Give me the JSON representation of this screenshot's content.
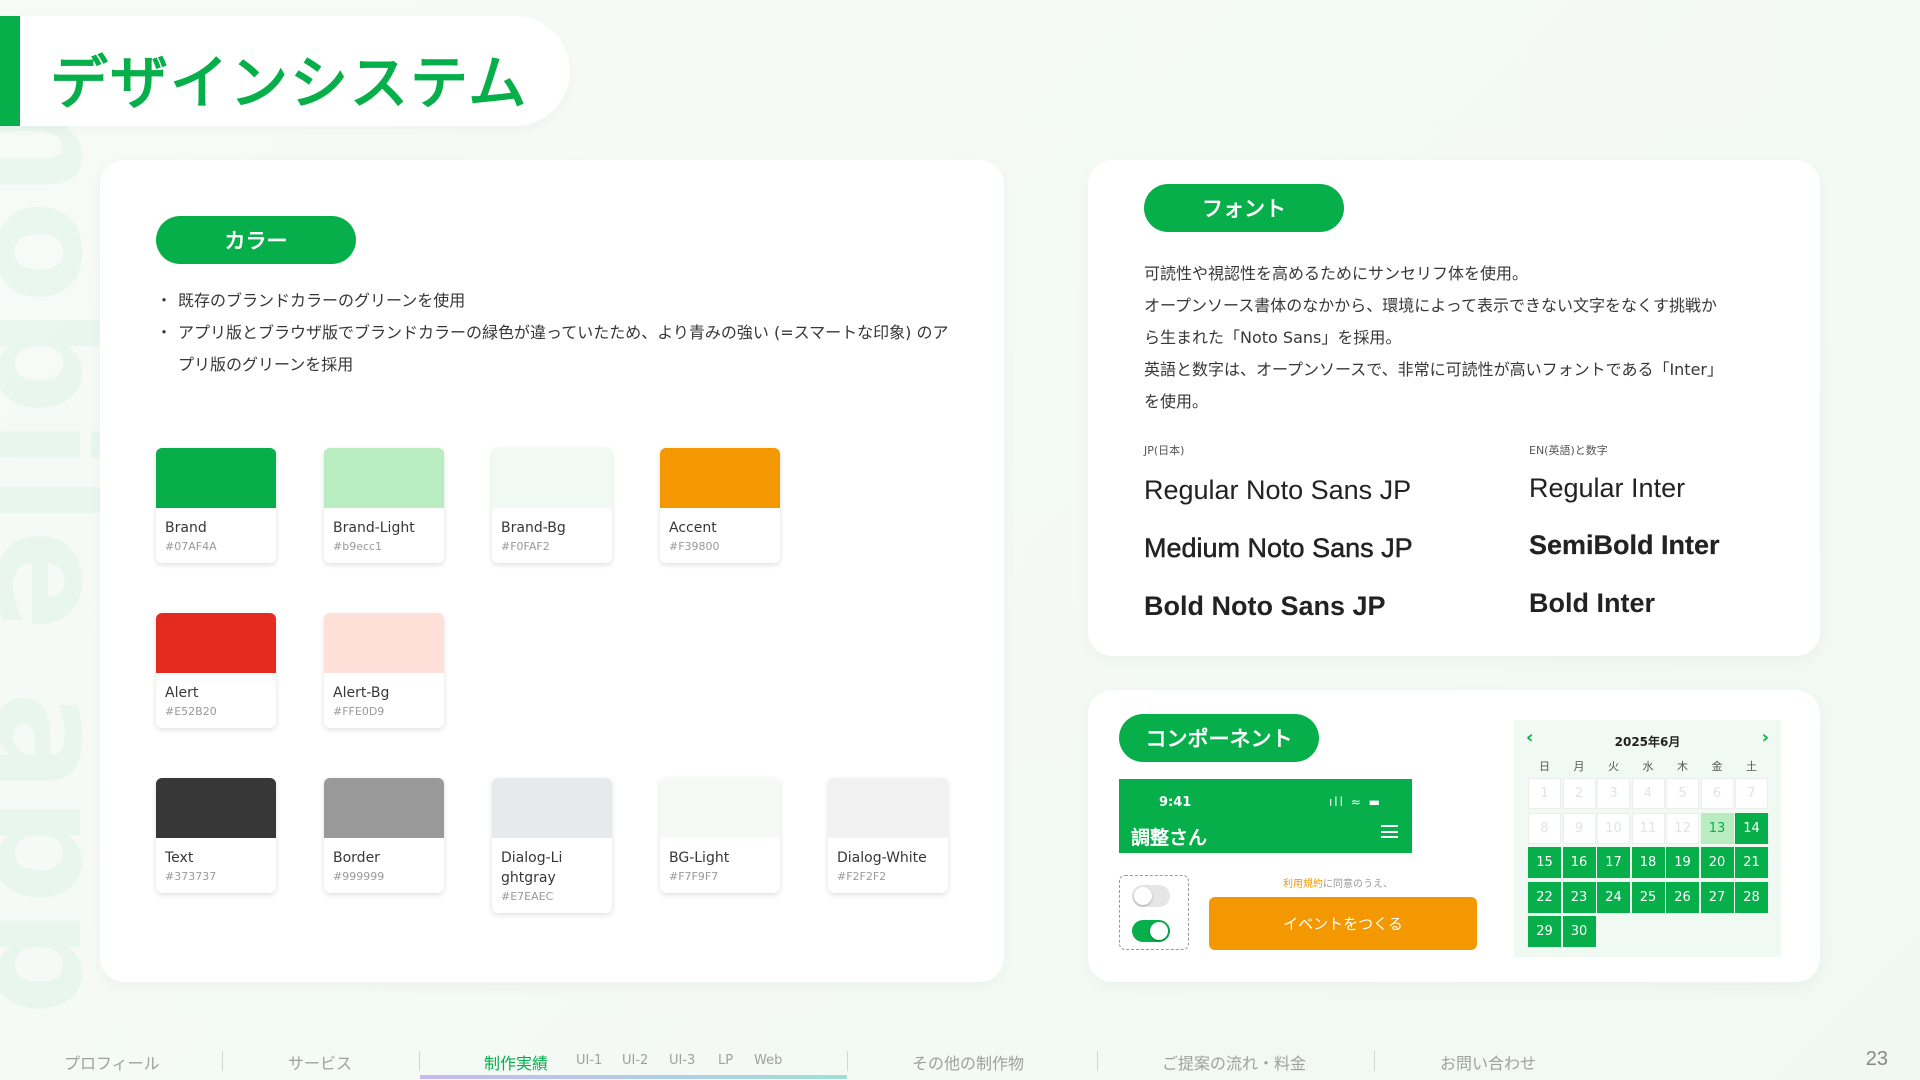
{
  "background_word": "mobile app",
  "page": {
    "title": "デザインシステム",
    "number": "23"
  },
  "colors_card": {
    "pill": "カラー",
    "bullets": [
      "既存のブランドカラーのグリーンを使用",
      "アプリ版とブラウザ版でブランドカラーの緑色が違っていたため、より青みの強い (=スマートな印象) のアプリ版のグリーンを採用"
    ],
    "swatches": [
      {
        "name": "Brand",
        "hex": "#07AF4A",
        "color": "#07AF4A"
      },
      {
        "name": "Brand-Light",
        "hex": "#b9ecc1",
        "color": "#b9ecc1"
      },
      {
        "name": "Brand-Bg",
        "hex": "#F0FAF2",
        "color": "#F0FAF2"
      },
      {
        "name": "Accent",
        "hex": "#F39800",
        "color": "#F39800"
      },
      {
        "name": "Alert",
        "hex": "#E52B20",
        "color": "#E52B20"
      },
      {
        "name": "Alert-Bg",
        "hex": "#FFE0D9",
        "color": "#FFE0D9"
      },
      {
        "name": "Text",
        "hex": "#373737",
        "color": "#373737"
      },
      {
        "name": "Border",
        "hex": "#999999",
        "color": "#999999"
      },
      {
        "name": "Dialog-Lightgray",
        "hex": "#E7EAEC",
        "color": "#E7EAEC"
      },
      {
        "name": "BG-Light",
        "hex": "#F7F9F7",
        "color": "#F7F9F7"
      },
      {
        "name": "Dialog-White",
        "hex": "#F2F2F2",
        "color": "#F2F2F2"
      }
    ]
  },
  "font_card": {
    "pill": "フォント",
    "description": [
      "可読性や視認性を高めるためにサンセリフ体を使用。",
      "オープンソース書体のなかから、環境によって表示できない文字をなくす挑戦か",
      "ら生まれた「Noto Sans」を採用。",
      "英語と数字は、オープンソースで、非常に可読性が高いフォントである「Inter」",
      "を使用。"
    ],
    "jp_label": "JP(日本)",
    "en_label": "EN(英語)と数字",
    "jp_samples": [
      "Regular Noto Sans JP",
      "Medium Noto Sans JP",
      "Bold Noto Sans JP"
    ],
    "en_samples": [
      "Regular Inter",
      "SemiBold Inter",
      "Bold Inter"
    ]
  },
  "components_card": {
    "pill": "コンポーネント",
    "phone": {
      "time": "9:41",
      "status": "ıll ≈ ▬",
      "title": "調整さん"
    },
    "terms_link": "利用規約",
    "terms_rest": "に同意のうえ、",
    "cta_label": "イベントをつくる",
    "calendar": {
      "title": "2025年6月",
      "prev": "‹",
      "next": "›",
      "weekdays": [
        "日",
        "月",
        "火",
        "水",
        "木",
        "金",
        "土"
      ],
      "past_days": [
        1,
        2,
        3,
        4,
        5,
        6,
        7,
        8,
        9,
        10,
        11,
        12
      ],
      "today": 13,
      "available_days": [
        14,
        15,
        16,
        17,
        18,
        19,
        20,
        21,
        22,
        23,
        24,
        25,
        26,
        27,
        28,
        29,
        30
      ]
    }
  },
  "footer": {
    "nav": [
      {
        "label": "プロフィール"
      },
      {
        "label": "サービス"
      },
      {
        "label": "制作実績",
        "active": true
      },
      {
        "label": "その他の制作物"
      },
      {
        "label": "ご提案の流れ・料金"
      },
      {
        "label": "お問い合わせ"
      }
    ],
    "sub_nav": [
      "UI-1",
      "UI-2",
      "UI-3",
      "LP",
      "Web"
    ]
  }
}
